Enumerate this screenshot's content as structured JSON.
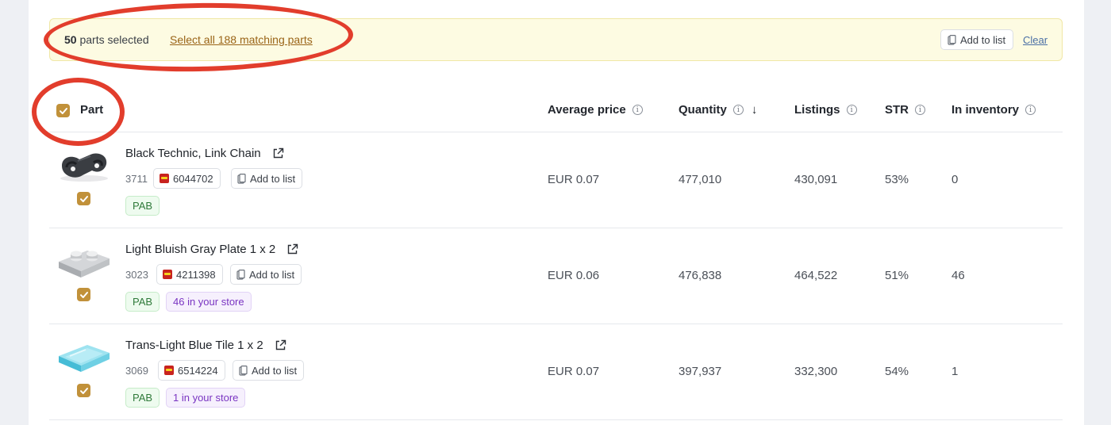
{
  "selection": {
    "count": "50",
    "count_suffix": "parts selected",
    "select_all_label": "Select all 188 matching parts",
    "add_to_list_label": "Add to list",
    "clear_label": "Clear"
  },
  "table": {
    "columns": {
      "part": "Part",
      "avg_price": "Average price",
      "quantity": "Quantity",
      "listings": "Listings",
      "str": "STR",
      "inventory": "In inventory"
    },
    "sorted_by": "quantity",
    "sort_direction": "descending",
    "rows": [
      {
        "name": "Black Technic, Link Chain",
        "number": "3711",
        "lego_id": "6044702",
        "add_label": "Add to list",
        "tags": [
          "PAB"
        ],
        "avg_price": "EUR 0.07",
        "quantity": "477,010",
        "listings": "430,091",
        "str": "53%",
        "inventory": "0",
        "selected": true
      },
      {
        "name": "Light Bluish Gray Plate 1 x 2",
        "number": "3023",
        "lego_id": "4211398",
        "add_label": "Add to list",
        "tags": [
          "PAB",
          "46 in your store"
        ],
        "avg_price": "EUR 0.06",
        "quantity": "476,838",
        "listings": "464,522",
        "str": "51%",
        "inventory": "46",
        "selected": true
      },
      {
        "name": "Trans-Light Blue Tile 1 x 2",
        "number": "3069",
        "lego_id": "6514224",
        "add_label": "Add to list",
        "tags": [
          "PAB",
          "1 in your store"
        ],
        "avg_price": "EUR 0.07",
        "quantity": "397,937",
        "listings": "332,300",
        "str": "54%",
        "inventory": "1",
        "selected": true
      }
    ]
  },
  "colors": {
    "accent": "#c1913a",
    "banner_bg": "#fdfbe2",
    "annotation": "#e23d2c",
    "tag_pab": "#2f7a3a",
    "tag_store": "#7a35c2"
  },
  "icons": {
    "checkbox": "checkmark-icon",
    "info": "info-icon",
    "sort": "arrow-down-icon",
    "external": "external-link-icon",
    "list": "clipboard-icon",
    "brand": "lego-logo-icon"
  }
}
